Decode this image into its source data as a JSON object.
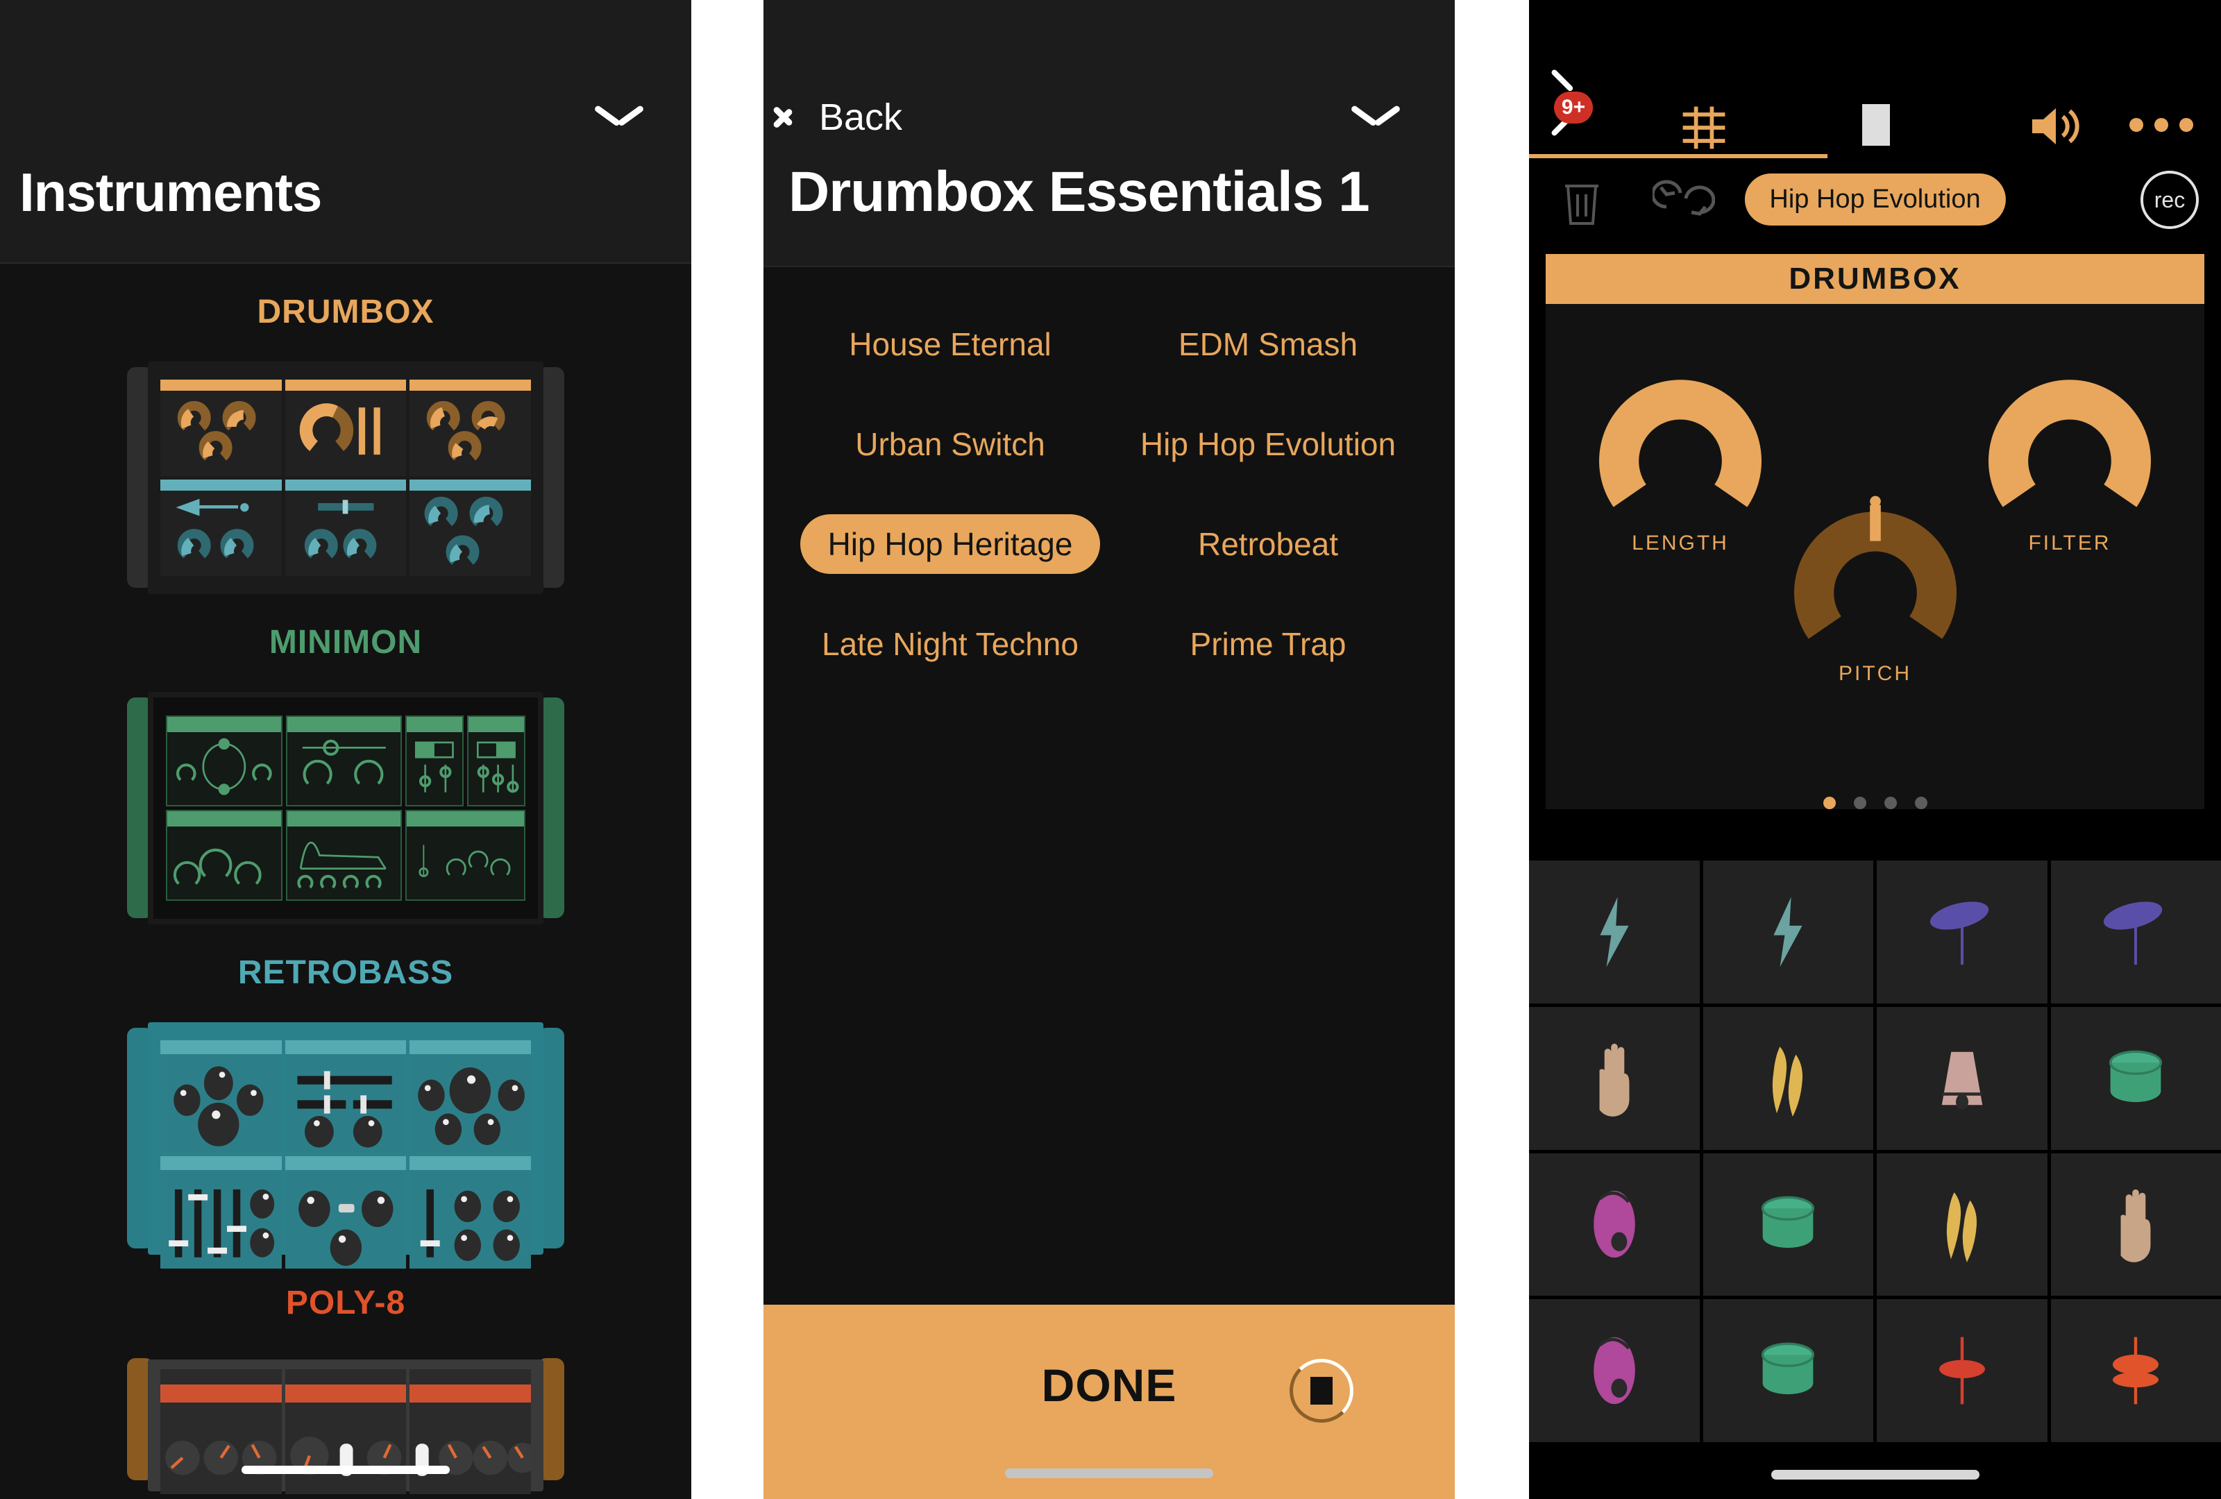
{
  "panels": {
    "instruments": {
      "title": "Instruments",
      "collapse_icon": "chevron-down-icon",
      "sections": [
        {
          "name": "DRUMBOX",
          "color": "#e8a75c"
        },
        {
          "name": "MINIMON",
          "color": "#4e9c6e"
        },
        {
          "name": "RETROBASS",
          "color": "#4fa9b4"
        },
        {
          "name": "POLY-8",
          "color": "#e0532b"
        }
      ]
    },
    "presets": {
      "back_label": "Back",
      "back_icon": "chevron-left-icon",
      "collapse_icon": "chevron-down-icon",
      "title": "Drumbox Essentials 1",
      "items": [
        {
          "label": "House Eternal",
          "selected": false
        },
        {
          "label": "EDM Smash",
          "selected": false
        },
        {
          "label": "Urban Switch",
          "selected": false
        },
        {
          "label": "Hip Hop Evolution",
          "selected": false
        },
        {
          "label": "Hip Hop Heritage",
          "selected": true
        },
        {
          "label": "Retrobeat",
          "selected": false
        },
        {
          "label": "Late Night Techno",
          "selected": false
        },
        {
          "label": "Prime Trap",
          "selected": false
        }
      ],
      "done_label": "DONE",
      "stop_icon": "stop-square-icon",
      "accent": "#e8a75c"
    },
    "player": {
      "toolbar": {
        "back_icon": "chevron-left-icon",
        "badge_count": "9+",
        "mixer_icon": "mixer-sliders-icon",
        "stop_icon": "stop-square-icon",
        "speaker_icon": "speaker-volume-icon",
        "more_icon": "more-dots-icon"
      },
      "subbar": {
        "trash_icon": "trash-icon",
        "undo_icon": "undo-redo-icon",
        "preset_name": "Hip Hop Evolution",
        "rec_label": "rec"
      },
      "instrument": {
        "name": "DRUMBOX",
        "knobs": [
          {
            "label": "LENGTH",
            "value": 100,
            "color": "#e8a75c"
          },
          {
            "label": "FILTER",
            "value": 100,
            "color": "#e8a75c"
          },
          {
            "label": "PITCH",
            "value": 50,
            "color": "#7a4e1b"
          }
        ]
      },
      "page_dots": {
        "count": 4,
        "active": 1
      },
      "pads": [
        {
          "icon": "lightning-bolt-icon",
          "color": "#6aa3a0"
        },
        {
          "icon": "lightning-bolt-icon",
          "color": "#6aa3a0"
        },
        {
          "icon": "cymbal-icon",
          "color": "#5a4fa8"
        },
        {
          "icon": "cymbal-icon",
          "color": "#5a4fa8"
        },
        {
          "icon": "hand-clap-icon",
          "color": "#c9a587"
        },
        {
          "icon": "maracas-icon",
          "color": "#e0b653"
        },
        {
          "icon": "conga-cone-icon",
          "color": "#c9a29b"
        },
        {
          "icon": "drum-cylinder-icon",
          "color": "#3ea077"
        },
        {
          "icon": "egg-shaker-icon",
          "color": "#b0489b"
        },
        {
          "icon": "drum-cylinder-icon",
          "color": "#3ea077"
        },
        {
          "icon": "maracas-icon",
          "color": "#e0b653"
        },
        {
          "icon": "hand-clap-icon",
          "color": "#c9a587"
        },
        {
          "icon": "egg-shaker-icon",
          "color": "#b0489b"
        },
        {
          "icon": "drum-cylinder-icon",
          "color": "#3ea077"
        },
        {
          "icon": "hihat-closed-icon",
          "color": "#d6402e"
        },
        {
          "icon": "hihat-open-icon",
          "color": "#e0532b"
        }
      ]
    }
  }
}
